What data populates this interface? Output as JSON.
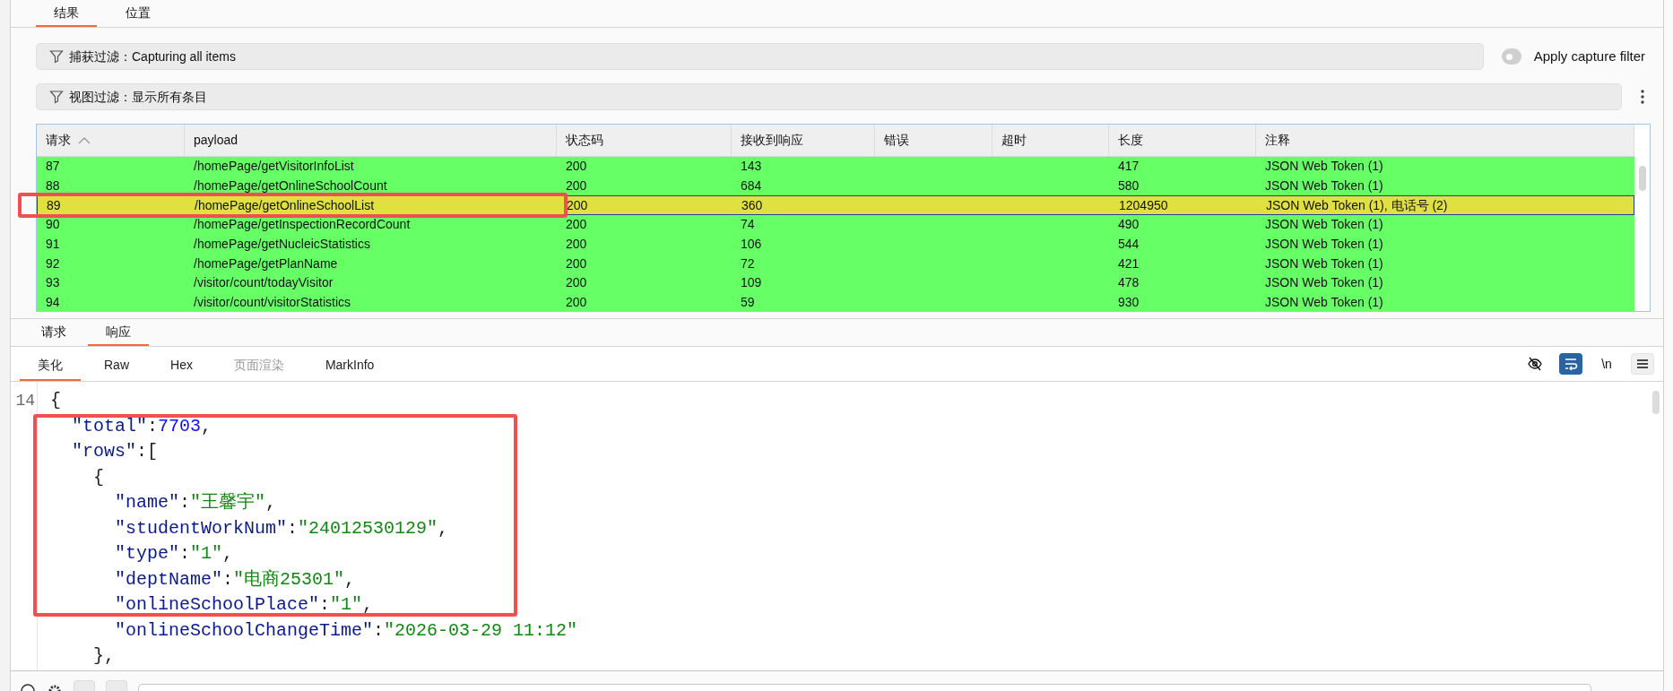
{
  "top_tabs": [
    {
      "label": "结果",
      "selected": true
    },
    {
      "label": "位置",
      "selected": false
    }
  ],
  "capture_filter": {
    "text": "捕获过滤：Capturing all items"
  },
  "capture_toggle": {
    "label": "Apply capture filter",
    "on": false
  },
  "view_filter": {
    "text": "视图过滤：显示所有条目"
  },
  "table": {
    "columns": [
      {
        "label": "请求",
        "sorted": true
      },
      {
        "label": "payload",
        "sorted": false
      },
      {
        "label": "状态码",
        "sorted": false
      },
      {
        "label": "接收到响应",
        "sorted": false
      },
      {
        "label": "错误",
        "sorted": false
      },
      {
        "label": "超时",
        "sorted": false
      },
      {
        "label": "长度",
        "sorted": false
      },
      {
        "label": "注释",
        "sorted": false
      }
    ],
    "rows": [
      {
        "selected": false,
        "cells": [
          "87",
          "/homePage/getVisitorInfoList",
          "200",
          "143",
          "",
          "",
          "417",
          "JSON Web Token (1)"
        ]
      },
      {
        "selected": false,
        "cells": [
          "88",
          "/homePage/getOnlineSchoolCount",
          "200",
          "684",
          "",
          "",
          "580",
          "JSON Web Token (1)"
        ]
      },
      {
        "selected": true,
        "cells": [
          "89",
          "/homePage/getOnlineSchoolList",
          "200",
          "360",
          "",
          "",
          "1204950",
          "JSON Web Token (1), 电话号 (2)"
        ]
      },
      {
        "selected": false,
        "cells": [
          "90",
          "/homePage/getInspectionRecordCount",
          "200",
          "74",
          "",
          "",
          "490",
          "JSON Web Token (1)"
        ]
      },
      {
        "selected": false,
        "cells": [
          "91",
          "/homePage/getNucleicStatistics",
          "200",
          "106",
          "",
          "",
          "544",
          "JSON Web Token (1)"
        ]
      },
      {
        "selected": false,
        "cells": [
          "92",
          "/homePage/getPlanName",
          "200",
          "72",
          "",
          "",
          "421",
          "JSON Web Token (1)"
        ]
      },
      {
        "selected": false,
        "cells": [
          "93",
          "/visitor/count/todayVisitor",
          "200",
          "109",
          "",
          "",
          "478",
          "JSON Web Token (1)"
        ]
      },
      {
        "selected": false,
        "cells": [
          "94",
          "/visitor/count/visitorStatistics",
          "200",
          "59",
          "",
          "",
          "930",
          "JSON Web Token (1)"
        ]
      }
    ]
  },
  "detail_tabs": [
    {
      "label": "请求",
      "selected": false
    },
    {
      "label": "响应",
      "selected": true
    }
  ],
  "view_tabs": [
    {
      "label": "美化",
      "selected": true,
      "disabled": false
    },
    {
      "label": "Raw",
      "selected": false,
      "disabled": false
    },
    {
      "label": "Hex",
      "selected": false,
      "disabled": false
    },
    {
      "label": "页面渲染",
      "selected": false,
      "disabled": true
    },
    {
      "label": "MarkInfo",
      "selected": false,
      "disabled": false
    }
  ],
  "toolbar": [
    {
      "kind": "eye-off",
      "on": false
    },
    {
      "kind": "wrap",
      "on": true
    },
    {
      "kind": "newline",
      "text": "\\n",
      "on": false
    },
    {
      "kind": "menu",
      "on": false
    }
  ],
  "code": {
    "lines": [
      {
        "number": "14",
        "tokens": [
          {
            "kind": "punct",
            "text": "{"
          }
        ]
      },
      {
        "tokens": [
          {
            "kind": "key",
            "text": "  \"total\""
          },
          {
            "kind": "punct",
            "text": ":"
          },
          {
            "kind": "number",
            "text": "7703"
          },
          {
            "kind": "punct",
            "text": ","
          }
        ]
      },
      {
        "tokens": [
          {
            "kind": "key",
            "text": "  \"rows\""
          },
          {
            "kind": "punct",
            "text": ":["
          }
        ]
      },
      {
        "tokens": [
          {
            "kind": "punct",
            "text": "    {"
          }
        ]
      },
      {
        "tokens": [
          {
            "kind": "key",
            "text": "      \"name\""
          },
          {
            "kind": "punct",
            "text": ":"
          },
          {
            "kind": "string",
            "text": "\"王馨宇\""
          },
          {
            "kind": "punct",
            "text": ","
          }
        ]
      },
      {
        "tokens": [
          {
            "kind": "key",
            "text": "      \"studentWorkNum\""
          },
          {
            "kind": "punct",
            "text": ":"
          },
          {
            "kind": "string",
            "text": "\"24012530129\""
          },
          {
            "kind": "punct",
            "text": ","
          }
        ]
      },
      {
        "tokens": [
          {
            "kind": "key",
            "text": "      \"type\""
          },
          {
            "kind": "punct",
            "text": ":"
          },
          {
            "kind": "string",
            "text": "\"1\""
          },
          {
            "kind": "punct",
            "text": ","
          }
        ]
      },
      {
        "tokens": [
          {
            "kind": "key",
            "text": "      \"deptName\""
          },
          {
            "kind": "punct",
            "text": ":"
          },
          {
            "kind": "string",
            "text": "\"电商25301\""
          },
          {
            "kind": "punct",
            "text": ","
          }
        ]
      },
      {
        "tokens": [
          {
            "kind": "key",
            "text": "      \"onlineSchoolPlace\""
          },
          {
            "kind": "punct",
            "text": ":"
          },
          {
            "kind": "string",
            "text": "\"1\""
          },
          {
            "kind": "punct",
            "text": ","
          }
        ]
      },
      {
        "tokens": [
          {
            "kind": "key",
            "text": "      \"onlineSchoolChangeTime\""
          },
          {
            "kind": "punct",
            "text": ":"
          },
          {
            "kind": "string",
            "text": "\"2026-03-29 11:12\""
          }
        ]
      },
      {
        "tokens": [
          {
            "kind": "punct",
            "text": "    },"
          }
        ]
      }
    ]
  }
}
